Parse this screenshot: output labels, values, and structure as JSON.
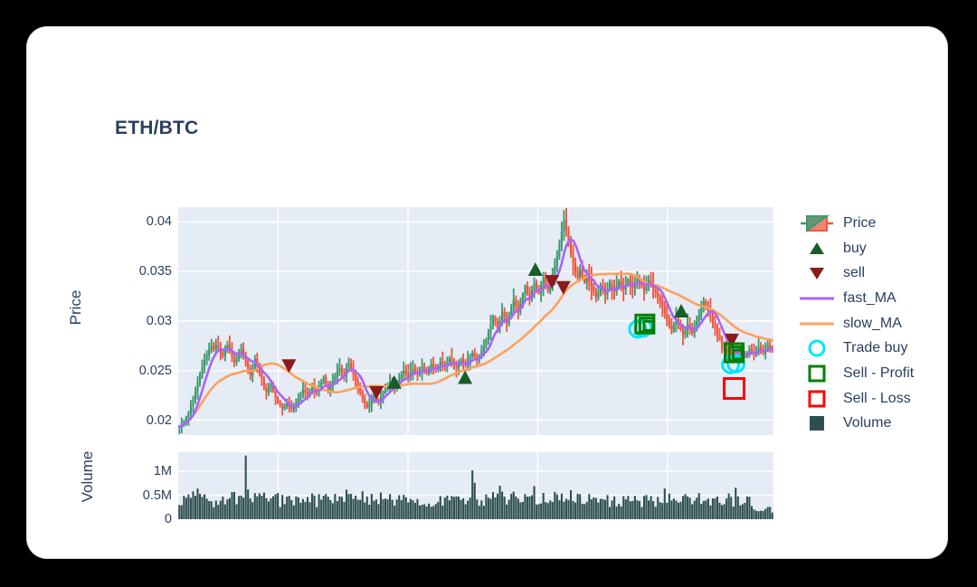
{
  "card": {
    "title": "ETH/BTC"
  },
  "axes": {
    "price_label": "Price",
    "volume_label": "Volume",
    "price_ticks": [
      "0.04",
      "0.035",
      "0.03",
      "0.025",
      "0.02"
    ],
    "volume_ticks": [
      "1M",
      "0.5M",
      "0"
    ]
  },
  "legend": {
    "items": [
      {
        "label": "Price",
        "icon": "candlestick-icon",
        "color": "#3d9970"
      },
      {
        "label": "buy",
        "icon": "triangle-up-icon",
        "color": "#1a5c2a"
      },
      {
        "label": "sell",
        "icon": "triangle-down-icon",
        "color": "#8b1a1a"
      },
      {
        "label": "fast_MA",
        "icon": "line-icon",
        "color": "#ab63fa"
      },
      {
        "label": "slow_MA",
        "icon": "line-icon",
        "color": "#ffa15a"
      },
      {
        "label": "Trade buy",
        "icon": "circle-open-icon",
        "color": "#00e5ff"
      },
      {
        "label": "Sell - Profit",
        "icon": "square-open-icon",
        "color": "#008000"
      },
      {
        "label": "Sell - Loss",
        "icon": "square-open-icon",
        "color": "#ff0000"
      },
      {
        "label": "Volume",
        "icon": "square-filled-icon",
        "color": "#2f4f4f"
      }
    ]
  },
  "chart_data": {
    "type": "line",
    "title": "ETH/BTC",
    "xlabel": "",
    "ylabel": "Price",
    "ylim": [
      0.0185,
      0.0415
    ],
    "volume_ylim": [
      0,
      1400000
    ],
    "grid": true,
    "legend_position": "right",
    "colors": {
      "up_candle": "#3d9970",
      "down_candle": "#ef553b",
      "fast_ma": "#ab63fa",
      "slow_ma": "#ffa15a",
      "volume": "#2f4f4f",
      "plot_bg": "#e5ecf6",
      "grid": "#ffffff",
      "text": "#2a3f5f",
      "buy_marker": "#1a5c2a",
      "sell_marker": "#8b1a1a",
      "trade_buy": "#00e5ff",
      "sell_profit": "#008000",
      "sell_loss": "#ff0000"
    },
    "series": [
      {
        "name": "Price",
        "type": "candlestick"
      },
      {
        "name": "fast_MA",
        "type": "line"
      },
      {
        "name": "slow_MA",
        "type": "line"
      },
      {
        "name": "Volume",
        "type": "bar"
      }
    ],
    "close": [
      0.0193,
      0.0196,
      0.0199,
      0.0203,
      0.0207,
      0.0214,
      0.0221,
      0.0229,
      0.0238,
      0.0246,
      0.0254,
      0.0261,
      0.0266,
      0.0271,
      0.0274,
      0.0272,
      0.0276,
      0.0273,
      0.0268,
      0.0265,
      0.0271,
      0.0276,
      0.0272,
      0.0264,
      0.0258,
      0.0262,
      0.0267,
      0.0272,
      0.0266,
      0.0259,
      0.0252,
      0.0245,
      0.0252,
      0.0262,
      0.0255,
      0.0248,
      0.0241,
      0.0234,
      0.0228,
      0.0232,
      0.0236,
      0.0229,
      0.0223,
      0.0218,
      0.0215,
      0.0212,
      0.0214,
      0.0217,
      0.0213,
      0.0211,
      0.0214,
      0.0218,
      0.0222,
      0.0226,
      0.0231,
      0.0228,
      0.0226,
      0.0229,
      0.0234,
      0.0231,
      0.0228,
      0.0233,
      0.0238,
      0.0243,
      0.0236,
      0.023,
      0.0234,
      0.0239,
      0.0244,
      0.0249,
      0.0253,
      0.0249,
      0.0245,
      0.0253,
      0.0258,
      0.0252,
      0.0246,
      0.024,
      0.0234,
      0.0228,
      0.0222,
      0.0217,
      0.0213,
      0.0216,
      0.022,
      0.0225,
      0.0221,
      0.0218,
      0.0223,
      0.0228,
      0.0232,
      0.0236,
      0.024,
      0.0236,
      0.0233,
      0.0237,
      0.0242,
      0.0246,
      0.025,
      0.0247,
      0.0244,
      0.0248,
      0.0252,
      0.0249,
      0.0246,
      0.025,
      0.0254,
      0.0251,
      0.0248,
      0.0252,
      0.0256,
      0.0253,
      0.0251,
      0.0255,
      0.0259,
      0.0256,
      0.0254,
      0.0258,
      0.0262,
      0.0259,
      0.0256,
      0.0253,
      0.0257,
      0.0261,
      0.0258,
      0.0255,
      0.0259,
      0.0264,
      0.0268,
      0.0264,
      0.0261,
      0.0265,
      0.027,
      0.0275,
      0.0281,
      0.0288,
      0.0296,
      0.0304,
      0.0299,
      0.0293,
      0.0301,
      0.0309,
      0.0303,
      0.0298,
      0.0306,
      0.0314,
      0.0322,
      0.0316,
      0.031,
      0.0318,
      0.0327,
      0.0335,
      0.0329,
      0.0323,
      0.0331,
      0.0339,
      0.0333,
      0.0328,
      0.0336,
      0.0344,
      0.0337,
      0.0331,
      0.0339,
      0.0347,
      0.0356,
      0.0366,
      0.0378,
      0.039,
      0.0402,
      0.0392,
      0.038,
      0.0368,
      0.0358,
      0.035,
      0.0344,
      0.0352,
      0.0345,
      0.0339,
      0.0347,
      0.0341,
      0.0335,
      0.0329,
      0.0324,
      0.033,
      0.0336,
      0.0331,
      0.0327,
      0.0333,
      0.0338,
      0.0334,
      0.033,
      0.0335,
      0.034,
      0.0336,
      0.0332,
      0.0337,
      0.0342,
      0.0338,
      0.0334,
      0.0339,
      0.0343,
      0.0339,
      0.0335,
      0.0331,
      0.0336,
      0.0341,
      0.0337,
      0.0333,
      0.0329,
      0.0325,
      0.032,
      0.0314,
      0.0308,
      0.0302,
      0.0296,
      0.029,
      0.0296,
      0.0302,
      0.0296,
      0.0291,
      0.0286,
      0.0291,
      0.0297,
      0.0292,
      0.0288,
      0.0294,
      0.03,
      0.0306,
      0.0313,
      0.032,
      0.0315,
      0.031,
      0.0305,
      0.0299,
      0.0293,
      0.0287,
      0.0282,
      0.0277,
      0.0272,
      0.0268,
      0.0273,
      0.0269,
      0.0265,
      0.0262,
      0.0266,
      0.0271,
      0.0267,
      0.0264,
      0.0268,
      0.0272,
      0.0269,
      0.0266,
      0.027,
      0.0274,
      0.0271,
      0.0268,
      0.0272,
      0.0276,
      0.0273,
      0.027
    ]
  },
  "markers": {
    "buy": [
      {
        "x": 0.363,
        "y": 0.0238
      },
      {
        "x": 0.482,
        "y": 0.0243
      },
      {
        "x": 0.6,
        "y": 0.0352
      },
      {
        "x": 0.845,
        "y": 0.031
      }
    ],
    "sell": [
      {
        "x": 0.186,
        "y": 0.0255
      },
      {
        "x": 0.333,
        "y": 0.0228
      },
      {
        "x": 0.628,
        "y": 0.034
      },
      {
        "x": 0.647,
        "y": 0.0334
      },
      {
        "x": 0.93,
        "y": 0.0281
      }
    ],
    "trade_buy": [
      {
        "x": 0.772,
        "y": 0.0292
      },
      {
        "x": 0.928,
        "y": 0.0256
      }
    ],
    "sell_profit": [
      {
        "x": 0.784,
        "y": 0.0297
      },
      {
        "x": 0.934,
        "y": 0.0268
      }
    ],
    "sell_loss": [
      {
        "x": 0.934,
        "y": 0.0232
      }
    ]
  }
}
